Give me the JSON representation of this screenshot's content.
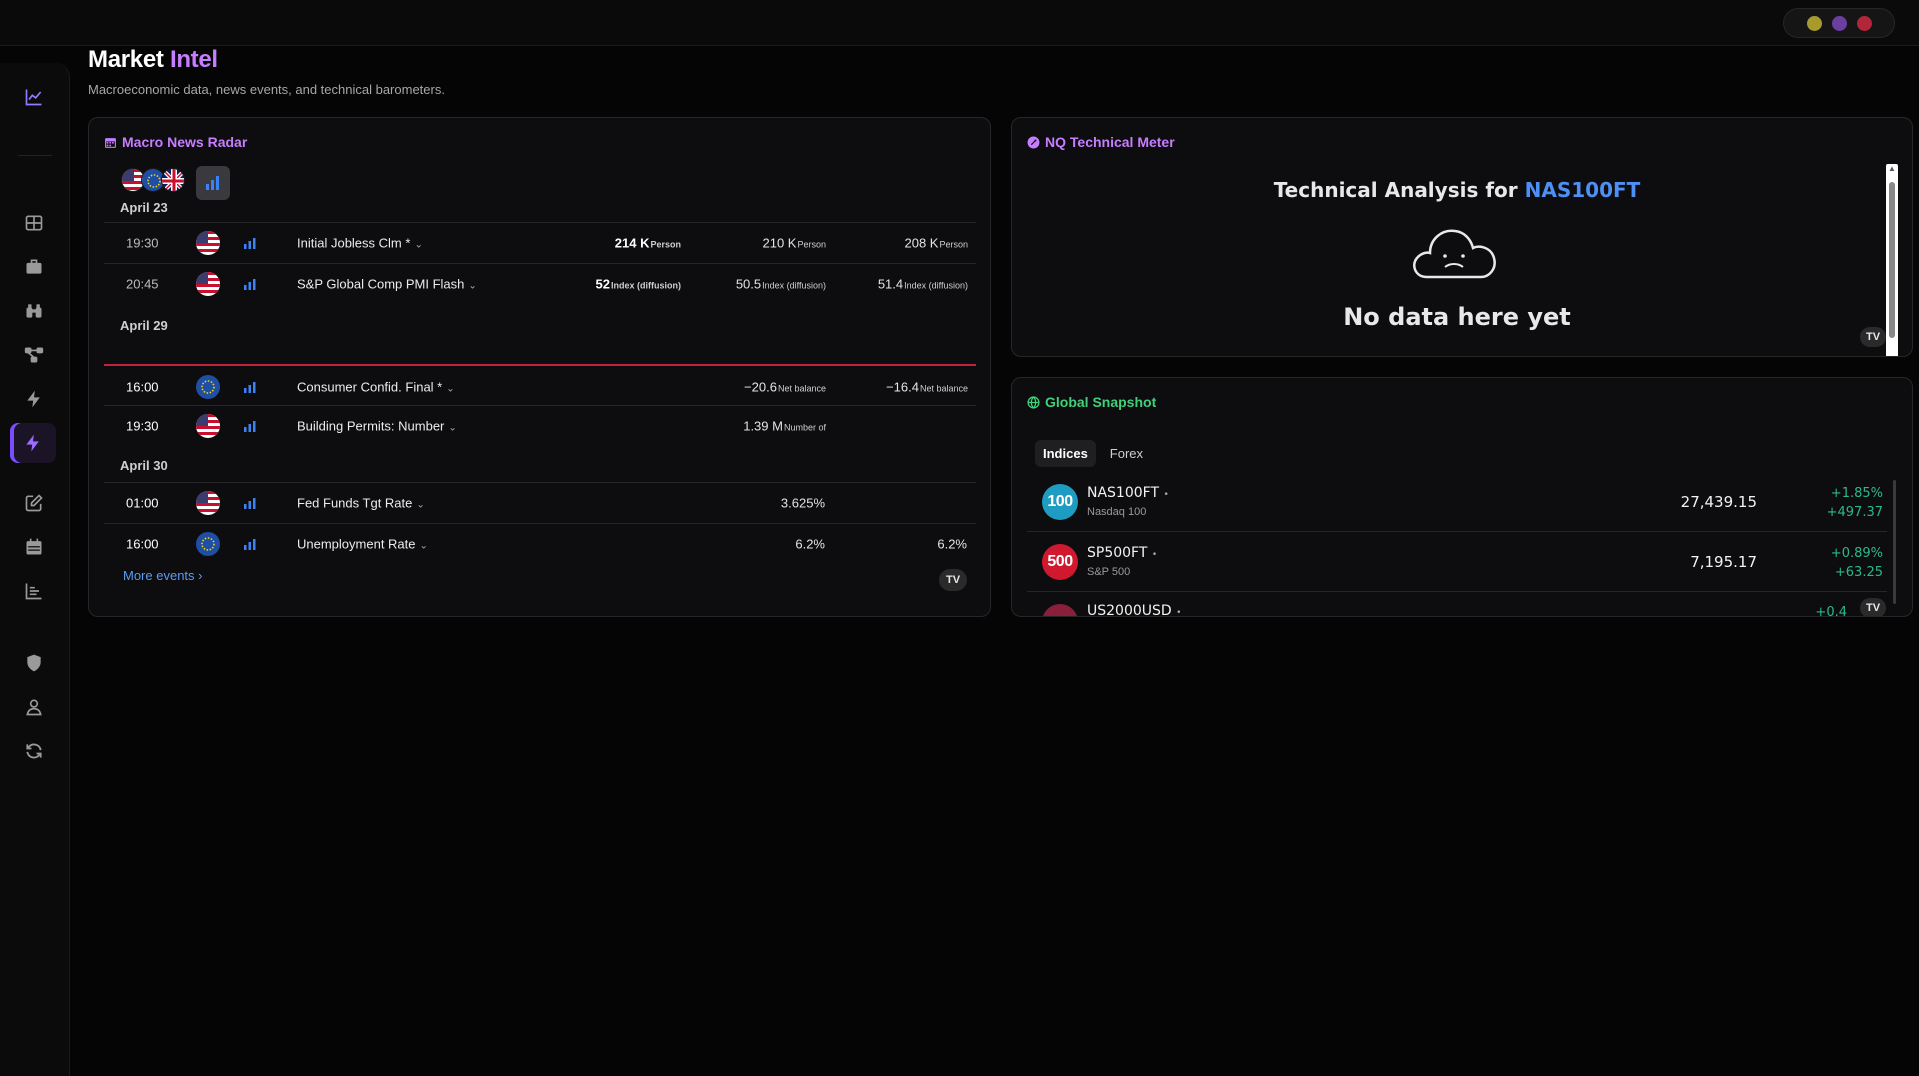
{
  "header": {
    "title_main": "Market",
    "title_accent": "Intel",
    "subtitle": "Macroeconomic data, news events, and technical barometers."
  },
  "window_controls": [
    "#a89a2c",
    "#6b3fa0",
    "#b3263a"
  ],
  "sidebar": {
    "items": [
      "chart-line-icon",
      "grid-icon",
      "briefcase-icon",
      "binoculars-icon",
      "network-icon",
      "bolt-icon",
      "bolt-active-icon",
      "edit-icon",
      "calendar-icon",
      "bar-chart-icon",
      "shield-icon",
      "user-icon",
      "refresh-icon"
    ],
    "active": "bolt-active-icon"
  },
  "macro": {
    "title": "Macro News Radar",
    "groups": [
      {
        "date": "April 23",
        "events": [
          {
            "time": "19:30",
            "country": "US",
            "name": "Initial Jobless Clm *",
            "actual": "214 K",
            "actual_unit": "Person",
            "forecast": "210 K",
            "forecast_unit": "Person",
            "prior": "208 K",
            "prior_unit": "Person"
          },
          {
            "time": "20:45",
            "country": "US",
            "name": "S&P Global Comp PMI Flash",
            "actual": "52",
            "actual_unit": "Index (diffusion)",
            "forecast": "50.5",
            "forecast_unit": "Index (diffusion)",
            "prior": "51.4",
            "prior_unit": "Index (diffusion)"
          }
        ]
      },
      {
        "date": "April 29",
        "events": [
          {
            "time": "16:00",
            "country": "EU",
            "name": "Consumer Confid. Final *",
            "actual": "",
            "actual_unit": "",
            "forecast": "−20.6",
            "forecast_unit": "Net balance",
            "prior": "−16.4",
            "prior_unit": "Net balance"
          },
          {
            "time": "19:30",
            "country": "US",
            "name": "Building Permits: Number",
            "actual": "",
            "actual_unit": "",
            "forecast": "1.39 M",
            "forecast_unit": "Number of",
            "prior": "",
            "prior_unit": ""
          }
        ]
      },
      {
        "date": "April 30",
        "events": [
          {
            "time": "01:00",
            "country": "US",
            "name": "Fed Funds Tgt Rate",
            "actual": "",
            "actual_unit": "",
            "forecast": "3.625%",
            "forecast_unit": "",
            "prior": "",
            "prior_unit": ""
          },
          {
            "time": "16:00",
            "country": "EU",
            "name": "Unemployment Rate",
            "actual": "",
            "actual_unit": "",
            "forecast": "6.2%",
            "forecast_unit": "",
            "prior": "6.2%",
            "prior_unit": ""
          }
        ]
      }
    ],
    "more_label": "More events",
    "more_chevron": "›",
    "tv_badge": "TV"
  },
  "tech": {
    "title": "NQ Technical Meter",
    "heading_prefix": "Technical Analysis for",
    "symbol": "NAS100FT",
    "empty_message": "No data here yet",
    "tv_badge": "TV"
  },
  "snapshot": {
    "title": "Global Snapshot",
    "tabs": [
      "Indices",
      "Forex"
    ],
    "active_tab": "Indices",
    "rows": [
      {
        "icon_text": "100",
        "icon_color": "#1f9cc2",
        "symbol": "NAS100FT",
        "dot": "•",
        "name": "Nasdaq 100",
        "price": "27,439.15",
        "change_pct": "+1.85%",
        "change_abs": "+497.37"
      },
      {
        "icon_text": "500",
        "icon_color": "#d0192f",
        "symbol": "SP500FT",
        "dot": "•",
        "name": "S&P 500",
        "price": "7,195.17",
        "change_pct": "+0.89%",
        "change_abs": "+63.25"
      },
      {
        "icon_text": "",
        "icon_color": "#8a1f3a",
        "symbol": "US2000USD",
        "dot": "•",
        "name": "",
        "price": "",
        "change_pct": "+0.4",
        "change_abs": ""
      }
    ],
    "tv_badge": "TV"
  }
}
